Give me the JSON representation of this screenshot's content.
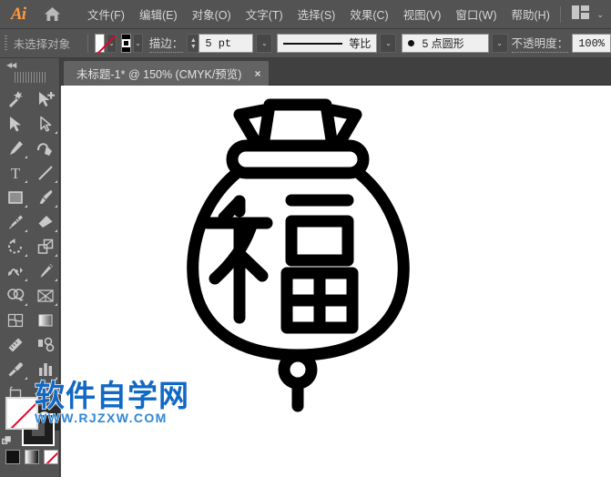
{
  "app": {
    "name": "Ai",
    "logo_color": "#ff9a3c"
  },
  "menubar": {
    "home_icon": "home-icon",
    "workspace_icon": "workspace-switcher-icon",
    "chevron": "⌄",
    "items": [
      {
        "label": "文件(F)"
      },
      {
        "label": "编辑(E)"
      },
      {
        "label": "对象(O)"
      },
      {
        "label": "文字(T)"
      },
      {
        "label": "选择(S)"
      },
      {
        "label": "效果(C)"
      },
      {
        "label": "视图(V)"
      },
      {
        "label": "窗口(W)"
      },
      {
        "label": "帮助(H)"
      }
    ]
  },
  "controlbar": {
    "selection_label": "未选择对象",
    "fill_swatch": "none",
    "stroke_swatch": "black",
    "stroke_label": "描边：",
    "stroke_weight": "5 pt",
    "profile_label": "等比",
    "brush_label": "5 点圆形",
    "opacity_label": "不透明度：",
    "opacity_value": "100%",
    "chevron": "⌄"
  },
  "tabbar": {
    "tab_title": "未标题-1* @ 150% (CMYK/预览)",
    "close_label": "×"
  },
  "toolbar": {
    "collapse_label": "◀◀",
    "tools": [
      {
        "name": "magic-wand-tool",
        "has_corner": false
      },
      {
        "name": "add-anchor-point-tool",
        "has_corner": false
      },
      {
        "name": "selection-tool",
        "has_corner": false
      },
      {
        "name": "direct-selection-tool",
        "has_corner": true
      },
      {
        "name": "pen-tool",
        "has_corner": true
      },
      {
        "name": "curvature-tool",
        "has_corner": false
      },
      {
        "name": "type-tool",
        "has_corner": true
      },
      {
        "name": "line-segment-tool",
        "has_corner": true
      },
      {
        "name": "rectangle-tool",
        "has_corner": true
      },
      {
        "name": "paintbrush-tool",
        "has_corner": true
      },
      {
        "name": "blob-brush-tool",
        "has_corner": true
      },
      {
        "name": "eraser-tool",
        "has_corner": true
      },
      {
        "name": "rotate-tool",
        "has_corner": true
      },
      {
        "name": "scale-tool",
        "has_corner": true
      },
      {
        "name": "width-tool",
        "has_corner": true
      },
      {
        "name": "free-transform-tool",
        "has_corner": false
      },
      {
        "name": "shape-builder-tool",
        "has_corner": true
      },
      {
        "name": "perspective-grid-tool",
        "has_corner": true
      },
      {
        "name": "mesh-tool",
        "has_corner": false
      },
      {
        "name": "gradient-tool",
        "has_corner": false
      },
      {
        "name": "measure-tool",
        "has_corner": false
      },
      {
        "name": "blend-tool",
        "has_corner": false
      },
      {
        "name": "eyedropper-tool",
        "has_corner": true
      },
      {
        "name": "column-graph-tool",
        "has_corner": true
      },
      {
        "name": "artboard-tool",
        "has_corner": false
      },
      {
        "name": "slice-tool",
        "has_corner": true
      },
      {
        "name": "hand-tool",
        "has_corner": true
      },
      {
        "name": "zoom-tool",
        "has_corner": false,
        "selected": true
      }
    ],
    "fill_stroke": {
      "fill": "none",
      "stroke": "#1d1d1d",
      "swap_icon": "swap-fill-stroke-icon"
    },
    "bottom_swatches": [
      {
        "name": "color-swatch",
        "kind": "black"
      },
      {
        "name": "gradient-swatch",
        "kind": "grad"
      },
      {
        "name": "none-swatch",
        "kind": "none"
      }
    ]
  },
  "canvas": {
    "artwork_name": "fortune-lucky-bag-illustration",
    "stroke_color": "#000000",
    "background": "#ffffff"
  },
  "watermark": {
    "cn_text": "软件自学网",
    "url_text": "WWW.RJZXW.COM",
    "color": "#1169c4"
  }
}
